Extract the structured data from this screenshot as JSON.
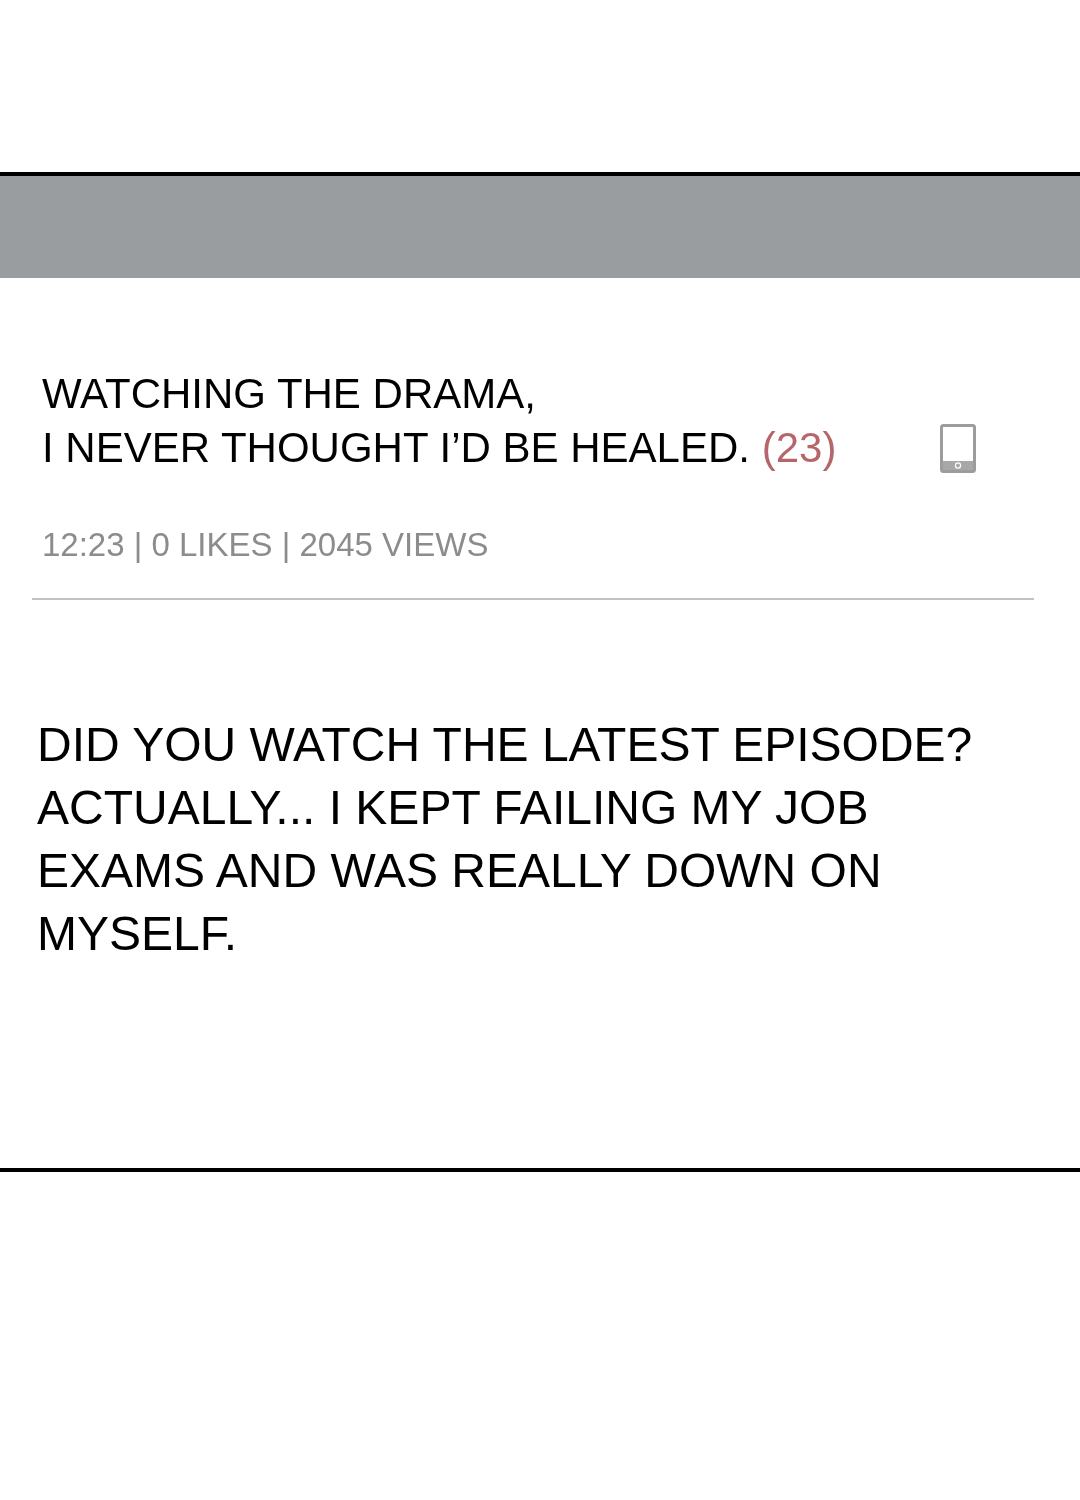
{
  "post": {
    "title": "WATCHING THE DRAMA,\nI NEVER THOUGHT I’D BE HEALED.",
    "comment_count": "(23)",
    "meta": "12:23 | 0 LIKES | 2045 VIEWS",
    "body": "DID YOU WATCH THE LATEST EPISODE? ACTUALLY... I KEPT FAILING MY JOB EXAMS AND WAS REALLY DOWN ON MYSELF."
  }
}
